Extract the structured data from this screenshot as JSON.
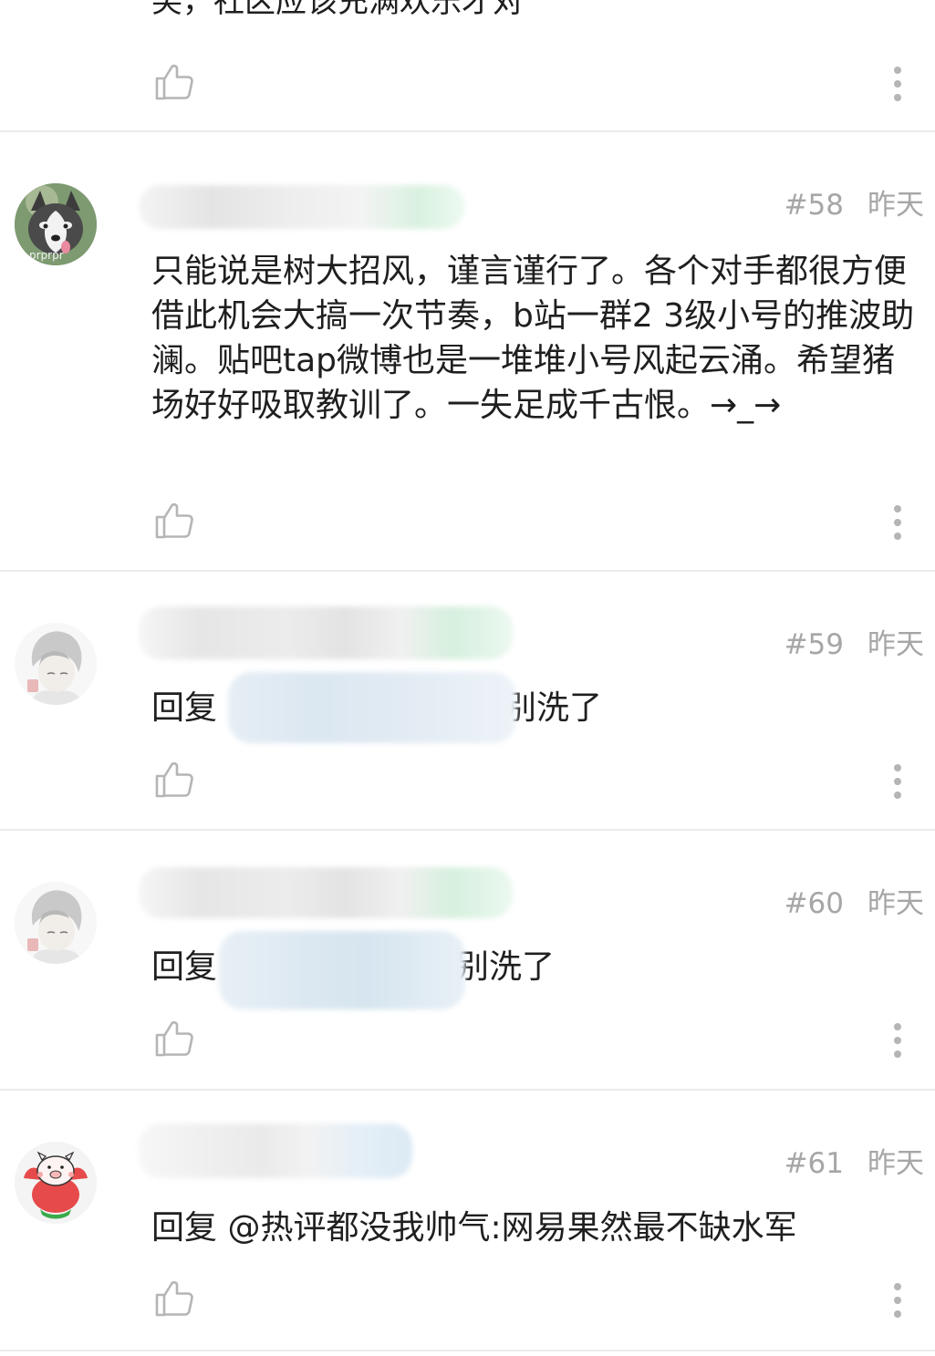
{
  "partial_comment": {
    "text": "笑，社区应该充满欢乐才对"
  },
  "comments": [
    {
      "floor": "#58",
      "time": "昨天",
      "avatar": "husky-dog-avatar",
      "avatar_caption": "prprpr",
      "body": "只能说是树大招风，谨言谨行了。各个对手都很方便借此机会大搞一次节奏，b站一群2 3级小号的推波助澜。贴吧tap微博也是一堆堆小号风起云涌。希望猪场好好吸取教训了。一失足成千古恨。→_→"
    },
    {
      "floor": "#59",
      "time": "昨天",
      "avatar": "anime-boy-avatar",
      "reply_prefix": "回复",
      "reply_suffix": "别洗了"
    },
    {
      "floor": "#60",
      "time": "昨天",
      "avatar": "anime-boy-avatar",
      "reply_prefix": "回复",
      "reply_suffix": "别洗了"
    },
    {
      "floor": "#61",
      "time": "昨天",
      "avatar": "pig-avatar",
      "reply_text": "回复 @热评都没我帅气:网易果然最不缺水军"
    }
  ],
  "icons": {
    "like": "thumbs-up-icon",
    "more": "more-vertical-icon"
  },
  "colors": {
    "meta_gray": "#a6a6a6",
    "divider": "#ececec",
    "text": "#1f1f1f"
  }
}
